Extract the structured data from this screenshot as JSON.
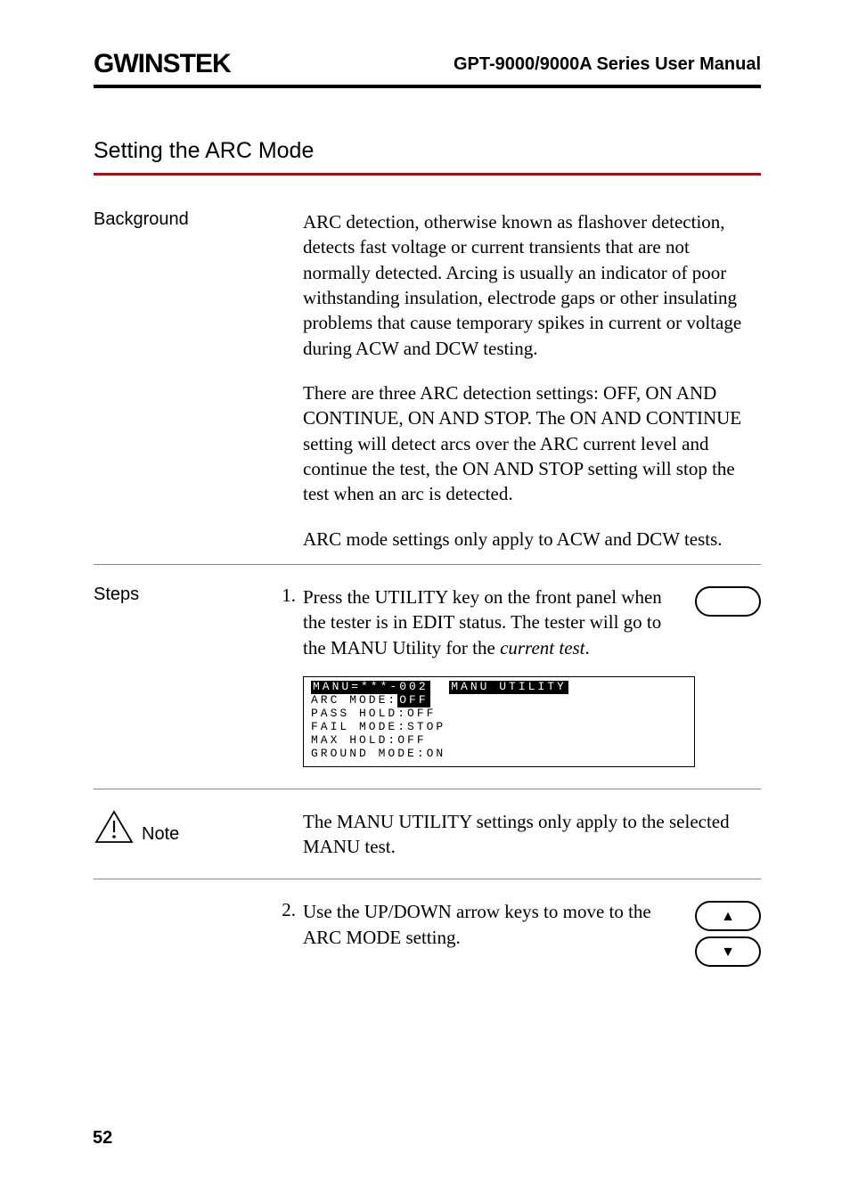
{
  "header": {
    "brand": "GWINSTEK",
    "manual_title": "GPT-9000/9000A Series User Manual"
  },
  "section_title": "Setting the ARC Mode",
  "background": {
    "label": "Background",
    "para1": "ARC detection, otherwise known as flashover detection, detects fast voltage or current transients that are not normally detected. Arcing is usually an indicator of poor withstanding insulation, electrode gaps or other insulating problems that cause temporary spikes in current or voltage during ACW and DCW testing.",
    "para2": "There are three ARC detection settings: OFF, ON AND CONTINUE, ON AND STOP. The ON AND CONTINUE setting will detect arcs over the ARC current level and continue the test, the ON AND STOP setting will stop the test when an arc is detected.",
    "para3": "ARC mode settings only apply to ACW and DCW tests."
  },
  "steps": {
    "label": "Steps",
    "s1_num": "1.",
    "s1_text_a": "Press the UTILITY key on the front panel when the tester is in EDIT status. The tester will go to the MANU Utility for the ",
    "s1_text_b": "current test",
    "s1_text_c": ".",
    "s2_num": "2.",
    "s2_text": "Use the UP/DOWN arrow keys to move to the ARC MODE setting."
  },
  "lcd": {
    "title_a": "MANU=***-002",
    "title_b": "MANU UTILITY",
    "l1a": "ARC  MODE:",
    "l1b": "OFF",
    "l2": "PASS HOLD:OFF",
    "l3": "FAIL MODE:STOP",
    "l4": "MAX  HOLD:OFF",
    "l5": "GROUND MODE:ON"
  },
  "note": {
    "label": "Note",
    "text": "The MANU UTILITY settings only apply to the selected MANU test."
  },
  "buttons": {
    "up": "▲",
    "down": "▼"
  },
  "page_number": "52"
}
